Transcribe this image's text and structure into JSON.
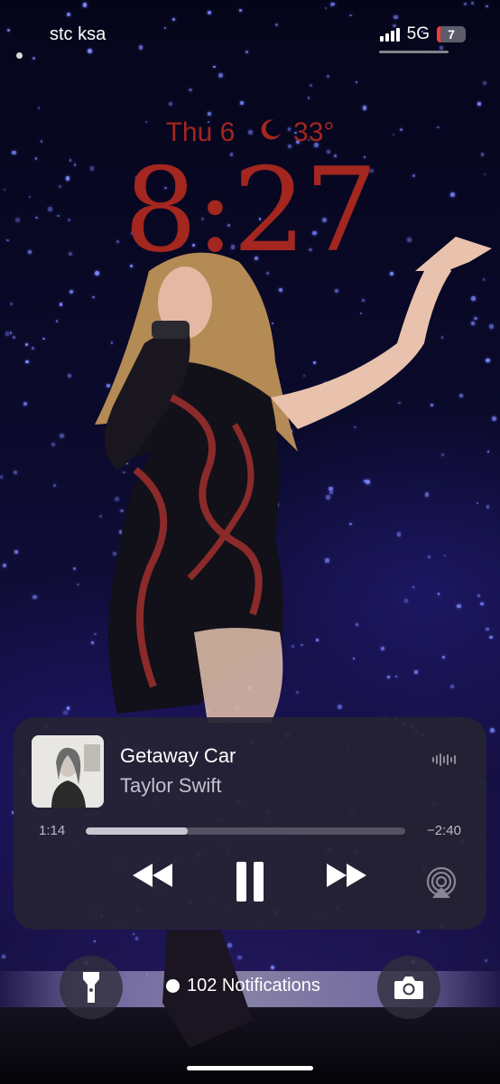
{
  "status_bar": {
    "carrier": "stc ksa",
    "network": "5G",
    "battery": "7",
    "battery_color": "#ff3b30"
  },
  "lock": {
    "date": "Thu 6",
    "weather_icon": "moon-icon",
    "temperature": "33°",
    "time": "8:27",
    "accent_color": "#a3261f"
  },
  "now_playing": {
    "title": "Getaway Car",
    "artist": "Taylor Swift",
    "album_art_text": "reputation",
    "elapsed": "1:14",
    "remaining": "−2:40",
    "progress_fraction": 0.32,
    "controls": [
      "rewind-icon",
      "pause-icon",
      "fast-forward-icon",
      "airplay-icon"
    ]
  },
  "bottom": {
    "left_button_icon": "flashlight-icon",
    "notifications": "102 Notifications",
    "right_button_icon": "camera-icon"
  }
}
